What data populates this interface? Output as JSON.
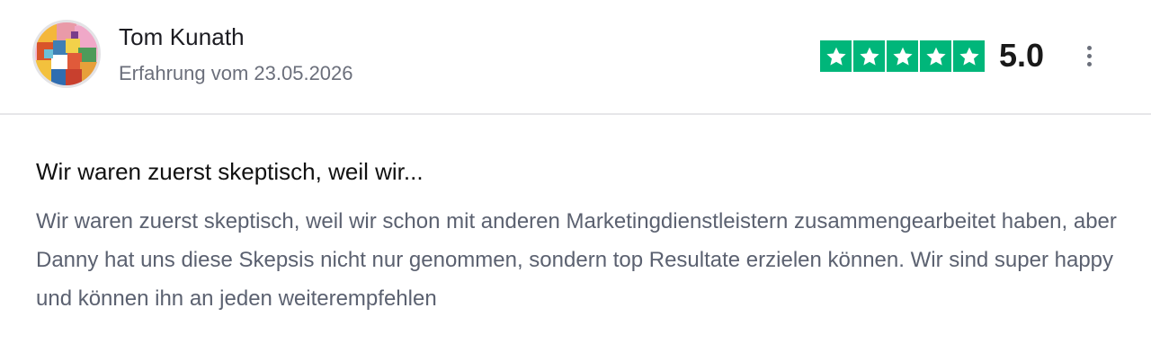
{
  "review": {
    "author": "Tom Kunath",
    "experience_date": "Erfahrung vom 23.05.2026",
    "rating": 5,
    "rating_text": "5.0",
    "star_color": "#00b67a",
    "title": "Wir waren zuerst skeptisch, weil wir...",
    "body": "Wir waren zuerst skeptisch, weil wir schon mit anderen Marketingdienstleistern zusammengearbeitet haben, aber Danny hat uns diese Skepsis nicht nur genommen, sondern top Resultate erzielen können. Wir sind super happy und können ihn an jeden weiterempfehlen"
  },
  "icons": {
    "star": "star-icon",
    "menu": "more-vertical-icon",
    "avatar": "user-avatar"
  }
}
